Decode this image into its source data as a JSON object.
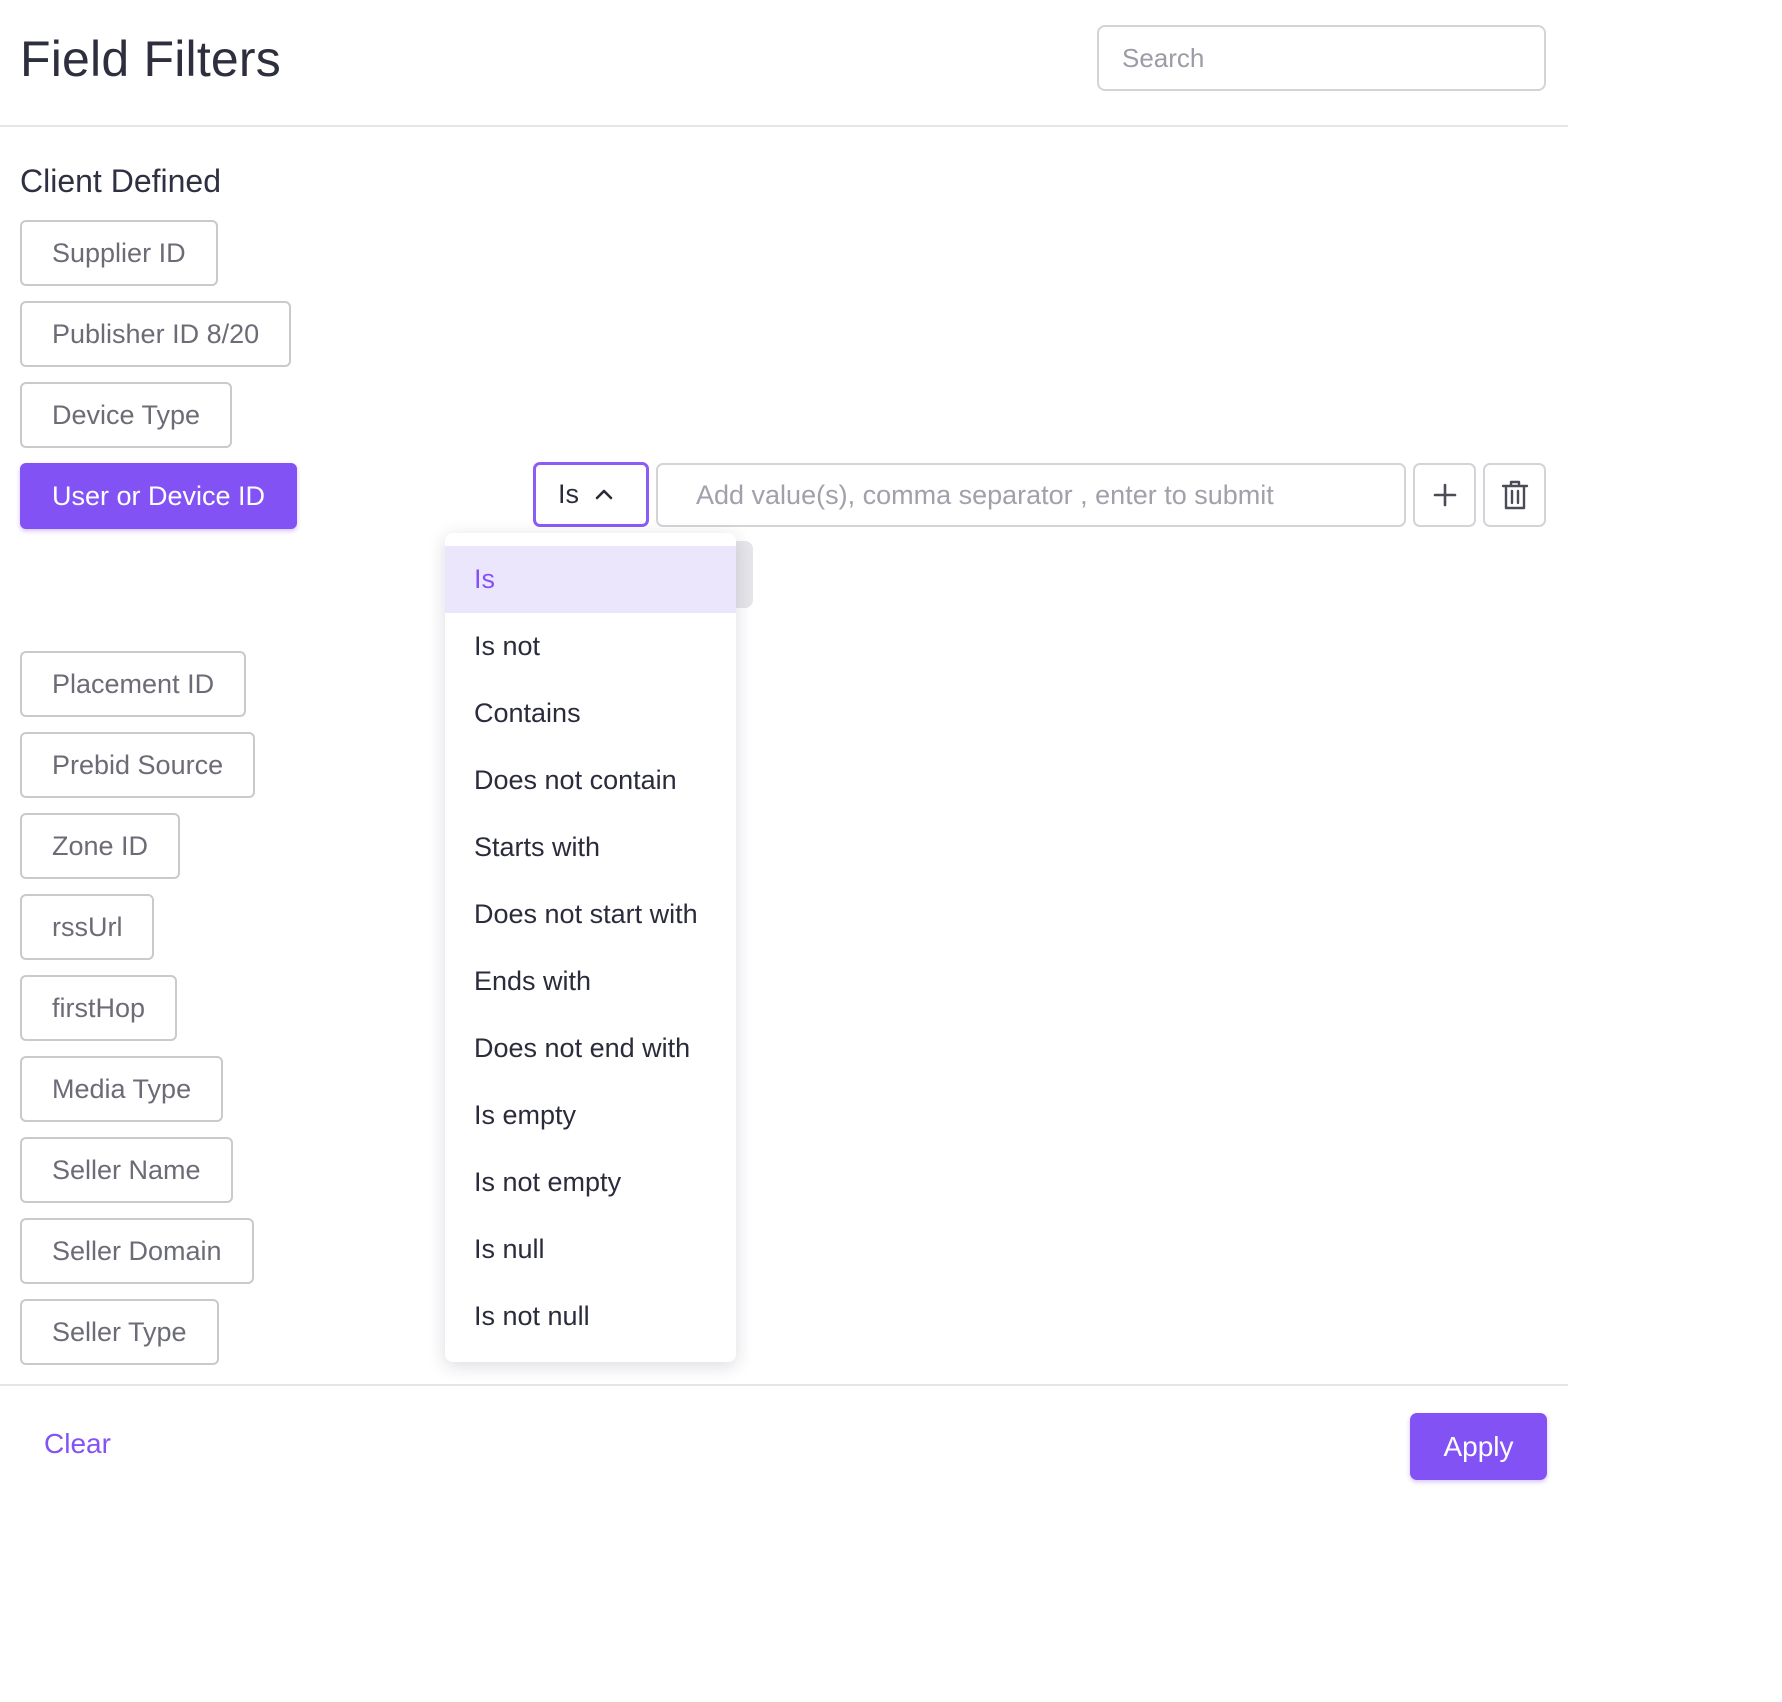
{
  "header": {
    "title": "Field Filters",
    "search_placeholder": "Search"
  },
  "section": {
    "title": "Client Defined"
  },
  "fields": [
    {
      "label": "Supplier ID"
    },
    {
      "label": "Publisher ID 8/20"
    },
    {
      "label": "Device Type"
    },
    {
      "label": "User or Device ID",
      "active": true
    },
    {
      "label": "Placement ID"
    },
    {
      "label": "Prebid Source"
    },
    {
      "label": "Zone ID"
    },
    {
      "label": "rssUrl"
    },
    {
      "label": "firstHop"
    },
    {
      "label": "Media Type"
    },
    {
      "label": "Seller Name"
    },
    {
      "label": "Seller Domain"
    },
    {
      "label": "Seller Type"
    }
  ],
  "filter_row": {
    "operator_selected": "Is",
    "value_placeholder": "Add value(s), comma separator , enter to submit",
    "add_icon": "plus-icon",
    "delete_icon": "trash-icon"
  },
  "operator_options": [
    "Is",
    "Is not",
    "Contains",
    "Does not contain",
    "Starts with",
    "Does not start with",
    "Ends with",
    "Does not end with",
    "Is empty",
    "Is not empty",
    "Is null",
    "Is not null"
  ],
  "footer": {
    "clear_label": "Clear",
    "apply_label": "Apply"
  },
  "colors": {
    "accent": "#8352f5",
    "selected_bg": "#ece6fd",
    "border": "#d4d4d8"
  }
}
